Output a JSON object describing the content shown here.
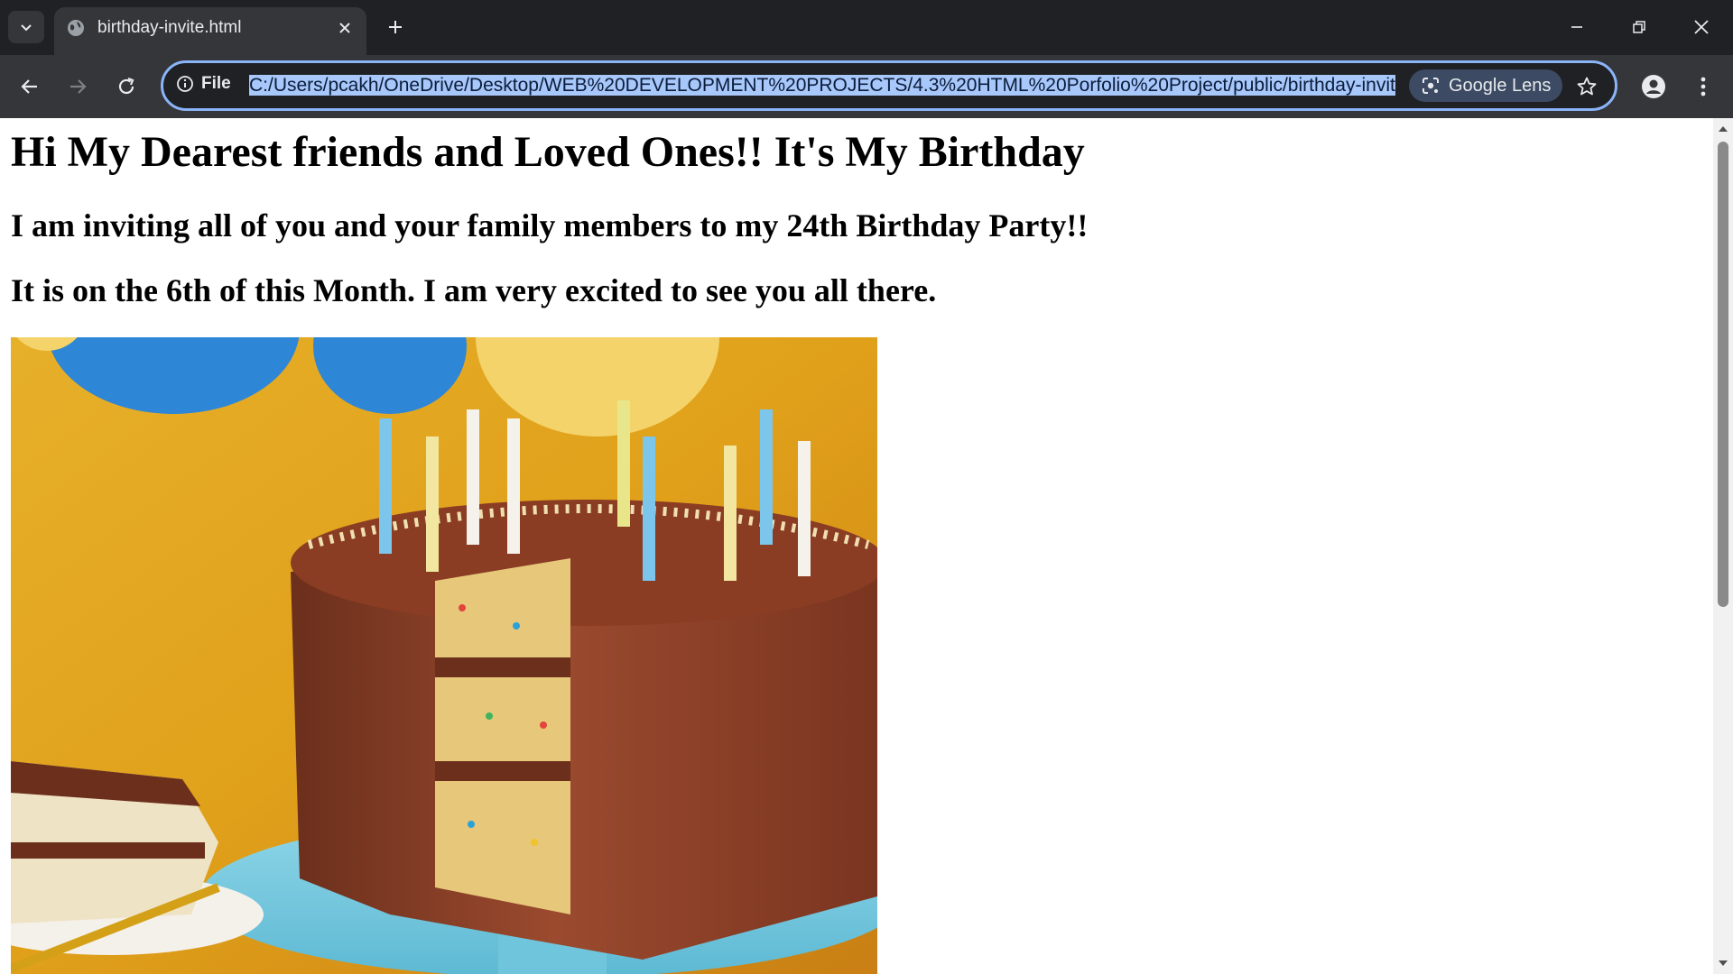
{
  "browser": {
    "tab": {
      "title": "birthday-invite.html",
      "favicon": "globe-icon"
    },
    "omnibox": {
      "scheme_label": "File",
      "url": "C:/Users/pcakh/OneDrive/Desktop/WEB%20DEVELOPMENT%20PROJECTS/4.3%20HTML%20Porfolio%20Project/public/birthday-invite.html",
      "lens_label": "Google Lens"
    },
    "colors": {
      "frame": "#202124",
      "toolbar": "#35363a",
      "focus_ring": "#8ab4f8",
      "url_selection": "#a8c7fa"
    }
  },
  "page": {
    "heading": "Hi My Dearest friends and Loved Ones!! It's My Birthday",
    "line1": "I am inviting all of you and your family members to my 24th Birthday Party!!",
    "line2": "It is on the 6th of this Month. I am very excited to see you all there."
  },
  "image": {
    "subject": "chocolate birthday cake with candles on blue cake stand, yellow background with balloons"
  }
}
